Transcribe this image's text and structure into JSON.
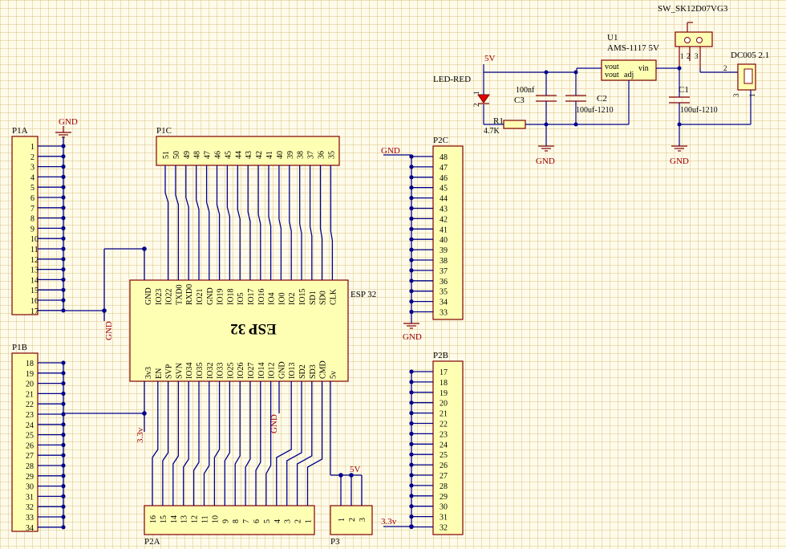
{
  "connectors": {
    "P1A": {
      "name": "P1A",
      "pins": [
        "1",
        "2",
        "3",
        "4",
        "5",
        "6",
        "7",
        "8",
        "9",
        "10",
        "11",
        "12",
        "13",
        "14",
        "15",
        "16",
        "17"
      ]
    },
    "P1B": {
      "name": "P1B",
      "pins": [
        "18",
        "19",
        "20",
        "21",
        "22",
        "23",
        "24",
        "25",
        "26",
        "27",
        "28",
        "29",
        "30",
        "31",
        "32",
        "33",
        "34"
      ]
    },
    "P1C": {
      "name": "P1C",
      "pins": [
        "51",
        "50",
        "49",
        "48",
        "47",
        "46",
        "45",
        "44",
        "43",
        "42",
        "41",
        "40",
        "39",
        "38",
        "37",
        "36",
        "35"
      ]
    },
    "P2A": {
      "name": "P2A",
      "pins": [
        "16",
        "15",
        "14",
        "13",
        "12",
        "11",
        "10",
        "9",
        "8",
        "7",
        "6",
        "5",
        "4",
        "3",
        "2",
        "1"
      ]
    },
    "P2B": {
      "name": "P2B",
      "pins": [
        "17",
        "18",
        "19",
        "20",
        "21",
        "22",
        "23",
        "24",
        "25",
        "26",
        "27",
        "28",
        "29",
        "30",
        "31",
        "32"
      ]
    },
    "P2C": {
      "name": "P2C",
      "pins": [
        "48",
        "47",
        "46",
        "45",
        "44",
        "43",
        "42",
        "41",
        "40",
        "39",
        "38",
        "37",
        "36",
        "35",
        "34",
        "33"
      ]
    },
    "P3": {
      "name": "P3",
      "pins": [
        "1",
        "2",
        "3"
      ]
    }
  },
  "esp32": {
    "designator": "ESP 32",
    "body_label": "ESP 32",
    "top_pins": [
      "GND",
      "IO23",
      "IO22",
      "TXD0",
      "RXD0",
      "IO21",
      "GND",
      "IO19",
      "IO18",
      "IO5",
      "IO17",
      "IO16",
      "IO4",
      "IO0",
      "IO2",
      "IO15",
      "SD1",
      "SD0",
      "CLK"
    ],
    "bottom_pins": [
      "3v3",
      "EN",
      "SVP",
      "SVN",
      "IO34",
      "IO35",
      "IO32",
      "IO33",
      "IO25",
      "IO26",
      "IO27",
      "IO14",
      "IO12",
      "GND",
      "IO13",
      "SD2",
      "SD3",
      "CMD",
      "5v"
    ]
  },
  "power_section": {
    "switch": "SW_SK12D07VG3",
    "regulator_designator": "U1",
    "regulator_value": "AMS-1117 5V",
    "regulator_pins": {
      "vout1": "vout",
      "vout2": "vout",
      "adj": "adj",
      "vin": "vin"
    },
    "jack": "DC005 2.1",
    "jack_pins": [
      "2",
      "3",
      "1"
    ],
    "switch_pins": [
      "1",
      "2",
      "3"
    ],
    "led": "LED-RED",
    "led_pins": [
      "1",
      "2"
    ],
    "c3_name": "C3",
    "c3_value": "100nf",
    "c2_name": "C2",
    "c2_value": "100uf-1210",
    "c1_name": "C1",
    "c1_value": "100uf-1210",
    "r1_name": "R1",
    "r1_value": "4.7K"
  },
  "nets": {
    "gnd": "GND",
    "v5": "5V",
    "v5_lower": "5v",
    "v33": "3.3v"
  }
}
